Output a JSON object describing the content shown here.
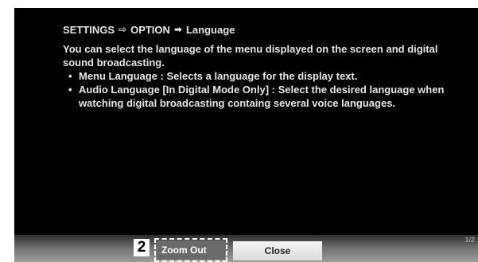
{
  "breadcrumb": {
    "root": "SETTINGS",
    "arrow1": "⇨",
    "middle": "OPTION",
    "arrow2": "➡",
    "current": "Language"
  },
  "description": "You can select the language of the menu displayed on the screen and digital sound broadcasting.",
  "bullets": [
    "Menu Language : Selects a language for the display text.",
    "Audio Language [In Digital Mode Only] : Select the desired language when watching digital broadcasting containg several voice languages."
  ],
  "bullet_glyph": "•",
  "page_indicator": "1/2",
  "step_number": "2",
  "buttons": {
    "zoom_out": "Zoom Out",
    "close": "Close"
  },
  "colors": {
    "panel_background": "#000000",
    "text": "#e6e6e6",
    "focus_outline": "#ffffff"
  }
}
